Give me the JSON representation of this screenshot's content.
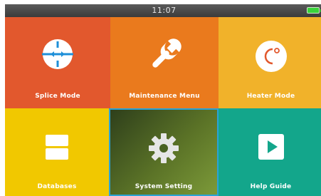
{
  "status_bar": {
    "time": "11:07",
    "battery_icon": "battery-full-icon",
    "battery_color": "#39d43a"
  },
  "tiles": [
    {
      "label": "Splice Mode",
      "icon": "crosshair-circle-icon",
      "color": "#e2582d"
    },
    {
      "label": "Maintenance Menu",
      "icon": "wrench-icon",
      "color": "#ea7a1d"
    },
    {
      "label": "Heater Mode",
      "icon": "heater-circle-icon",
      "color": "#f1b22a"
    },
    {
      "label": "Databases",
      "icon": "database-icon",
      "color": "#f1c800"
    },
    {
      "label": "System Setting",
      "icon": "gear-icon",
      "color": "#5b7327",
      "selected": true
    },
    {
      "label": "Help Guide",
      "icon": "play-icon",
      "color": "#13a68b"
    }
  ],
  "selection_color": "#2aa3d6"
}
